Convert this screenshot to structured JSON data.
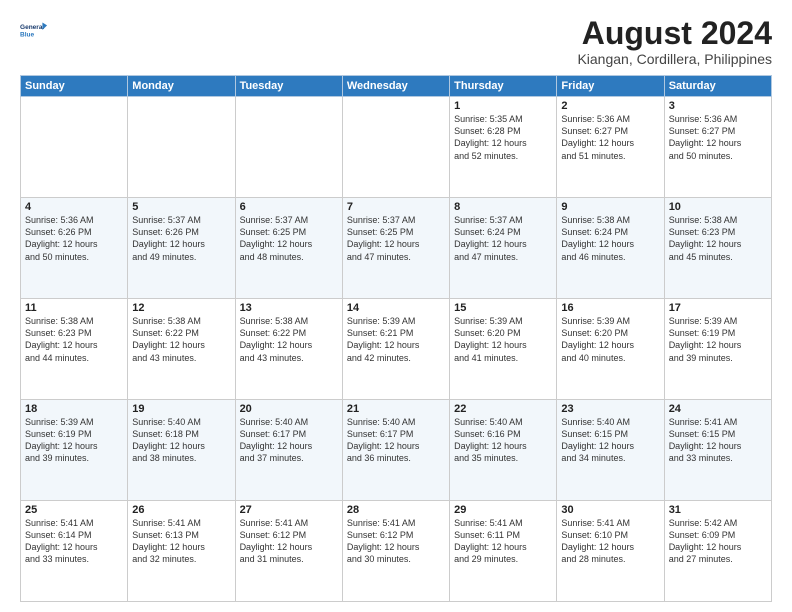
{
  "logo": {
    "line1": "General",
    "line2": "Blue"
  },
  "title": "August 2024",
  "subtitle": "Kiangan, Cordillera, Philippines",
  "weekdays": [
    "Sunday",
    "Monday",
    "Tuesday",
    "Wednesday",
    "Thursday",
    "Friday",
    "Saturday"
  ],
  "weeks": [
    [
      {
        "day": "",
        "info": ""
      },
      {
        "day": "",
        "info": ""
      },
      {
        "day": "",
        "info": ""
      },
      {
        "day": "",
        "info": ""
      },
      {
        "day": "1",
        "info": "Sunrise: 5:35 AM\nSunset: 6:28 PM\nDaylight: 12 hours\nand 52 minutes."
      },
      {
        "day": "2",
        "info": "Sunrise: 5:36 AM\nSunset: 6:27 PM\nDaylight: 12 hours\nand 51 minutes."
      },
      {
        "day": "3",
        "info": "Sunrise: 5:36 AM\nSunset: 6:27 PM\nDaylight: 12 hours\nand 50 minutes."
      }
    ],
    [
      {
        "day": "4",
        "info": "Sunrise: 5:36 AM\nSunset: 6:26 PM\nDaylight: 12 hours\nand 50 minutes."
      },
      {
        "day": "5",
        "info": "Sunrise: 5:37 AM\nSunset: 6:26 PM\nDaylight: 12 hours\nand 49 minutes."
      },
      {
        "day": "6",
        "info": "Sunrise: 5:37 AM\nSunset: 6:25 PM\nDaylight: 12 hours\nand 48 minutes."
      },
      {
        "day": "7",
        "info": "Sunrise: 5:37 AM\nSunset: 6:25 PM\nDaylight: 12 hours\nand 47 minutes."
      },
      {
        "day": "8",
        "info": "Sunrise: 5:37 AM\nSunset: 6:24 PM\nDaylight: 12 hours\nand 47 minutes."
      },
      {
        "day": "9",
        "info": "Sunrise: 5:38 AM\nSunset: 6:24 PM\nDaylight: 12 hours\nand 46 minutes."
      },
      {
        "day": "10",
        "info": "Sunrise: 5:38 AM\nSunset: 6:23 PM\nDaylight: 12 hours\nand 45 minutes."
      }
    ],
    [
      {
        "day": "11",
        "info": "Sunrise: 5:38 AM\nSunset: 6:23 PM\nDaylight: 12 hours\nand 44 minutes."
      },
      {
        "day": "12",
        "info": "Sunrise: 5:38 AM\nSunset: 6:22 PM\nDaylight: 12 hours\nand 43 minutes."
      },
      {
        "day": "13",
        "info": "Sunrise: 5:38 AM\nSunset: 6:22 PM\nDaylight: 12 hours\nand 43 minutes."
      },
      {
        "day": "14",
        "info": "Sunrise: 5:39 AM\nSunset: 6:21 PM\nDaylight: 12 hours\nand 42 minutes."
      },
      {
        "day": "15",
        "info": "Sunrise: 5:39 AM\nSunset: 6:20 PM\nDaylight: 12 hours\nand 41 minutes."
      },
      {
        "day": "16",
        "info": "Sunrise: 5:39 AM\nSunset: 6:20 PM\nDaylight: 12 hours\nand 40 minutes."
      },
      {
        "day": "17",
        "info": "Sunrise: 5:39 AM\nSunset: 6:19 PM\nDaylight: 12 hours\nand 39 minutes."
      }
    ],
    [
      {
        "day": "18",
        "info": "Sunrise: 5:39 AM\nSunset: 6:19 PM\nDaylight: 12 hours\nand 39 minutes."
      },
      {
        "day": "19",
        "info": "Sunrise: 5:40 AM\nSunset: 6:18 PM\nDaylight: 12 hours\nand 38 minutes."
      },
      {
        "day": "20",
        "info": "Sunrise: 5:40 AM\nSunset: 6:17 PM\nDaylight: 12 hours\nand 37 minutes."
      },
      {
        "day": "21",
        "info": "Sunrise: 5:40 AM\nSunset: 6:17 PM\nDaylight: 12 hours\nand 36 minutes."
      },
      {
        "day": "22",
        "info": "Sunrise: 5:40 AM\nSunset: 6:16 PM\nDaylight: 12 hours\nand 35 minutes."
      },
      {
        "day": "23",
        "info": "Sunrise: 5:40 AM\nSunset: 6:15 PM\nDaylight: 12 hours\nand 34 minutes."
      },
      {
        "day": "24",
        "info": "Sunrise: 5:41 AM\nSunset: 6:15 PM\nDaylight: 12 hours\nand 33 minutes."
      }
    ],
    [
      {
        "day": "25",
        "info": "Sunrise: 5:41 AM\nSunset: 6:14 PM\nDaylight: 12 hours\nand 33 minutes."
      },
      {
        "day": "26",
        "info": "Sunrise: 5:41 AM\nSunset: 6:13 PM\nDaylight: 12 hours\nand 32 minutes."
      },
      {
        "day": "27",
        "info": "Sunrise: 5:41 AM\nSunset: 6:12 PM\nDaylight: 12 hours\nand 31 minutes."
      },
      {
        "day": "28",
        "info": "Sunrise: 5:41 AM\nSunset: 6:12 PM\nDaylight: 12 hours\nand 30 minutes."
      },
      {
        "day": "29",
        "info": "Sunrise: 5:41 AM\nSunset: 6:11 PM\nDaylight: 12 hours\nand 29 minutes."
      },
      {
        "day": "30",
        "info": "Sunrise: 5:41 AM\nSunset: 6:10 PM\nDaylight: 12 hours\nand 28 minutes."
      },
      {
        "day": "31",
        "info": "Sunrise: 5:42 AM\nSunset: 6:09 PM\nDaylight: 12 hours\nand 27 minutes."
      }
    ]
  ]
}
